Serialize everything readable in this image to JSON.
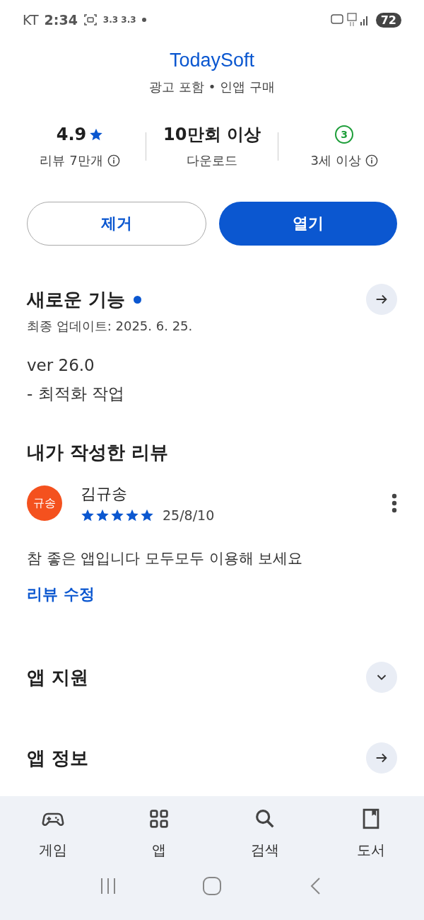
{
  "status_bar": {
    "carrier": "KT",
    "time": "2:34",
    "speeds": "3.3 3.3",
    "battery": "72"
  },
  "app": {
    "developer": "TodaySoft",
    "notes": "광고 포함 • 인앱 구매"
  },
  "stats": [
    {
      "kind": "rating",
      "value": "4.9",
      "label": "리뷰 7만개"
    },
    {
      "kind": "plain",
      "value": "10만회 이상",
      "label": "다운로드"
    },
    {
      "kind": "age",
      "value": "3",
      "label": "3세 이상"
    }
  ],
  "buttons": [
    {
      "label": "제거",
      "kind": "outlined"
    },
    {
      "label": "열기",
      "kind": "filled"
    }
  ],
  "whats_new": {
    "title": "새로운 기능",
    "new": true,
    "updated": "최종 업데이트: 2025. 6. 25.",
    "lines": [
      "ver 26.0",
      "- 최적화 작업"
    ]
  },
  "my_review": {
    "title": "내가 작성한 리뷰",
    "avatar": "규송",
    "author": "김규송",
    "stars": 5,
    "date": "25/8/10",
    "text": "참 좋은 앱입니다 모두모두 이용해 보세요",
    "edit_link": "리뷰 수정"
  },
  "sections": [
    {
      "title": "앱 지원",
      "kind": "expand"
    },
    {
      "title": "앱 정보",
      "kind": "arrow"
    }
  ],
  "bottom_nav": [
    {
      "label": "게임",
      "kind": "game"
    },
    {
      "label": "앱",
      "kind": "apps"
    },
    {
      "label": "검색",
      "kind": "search"
    },
    {
      "label": "도서",
      "kind": "book"
    }
  ]
}
